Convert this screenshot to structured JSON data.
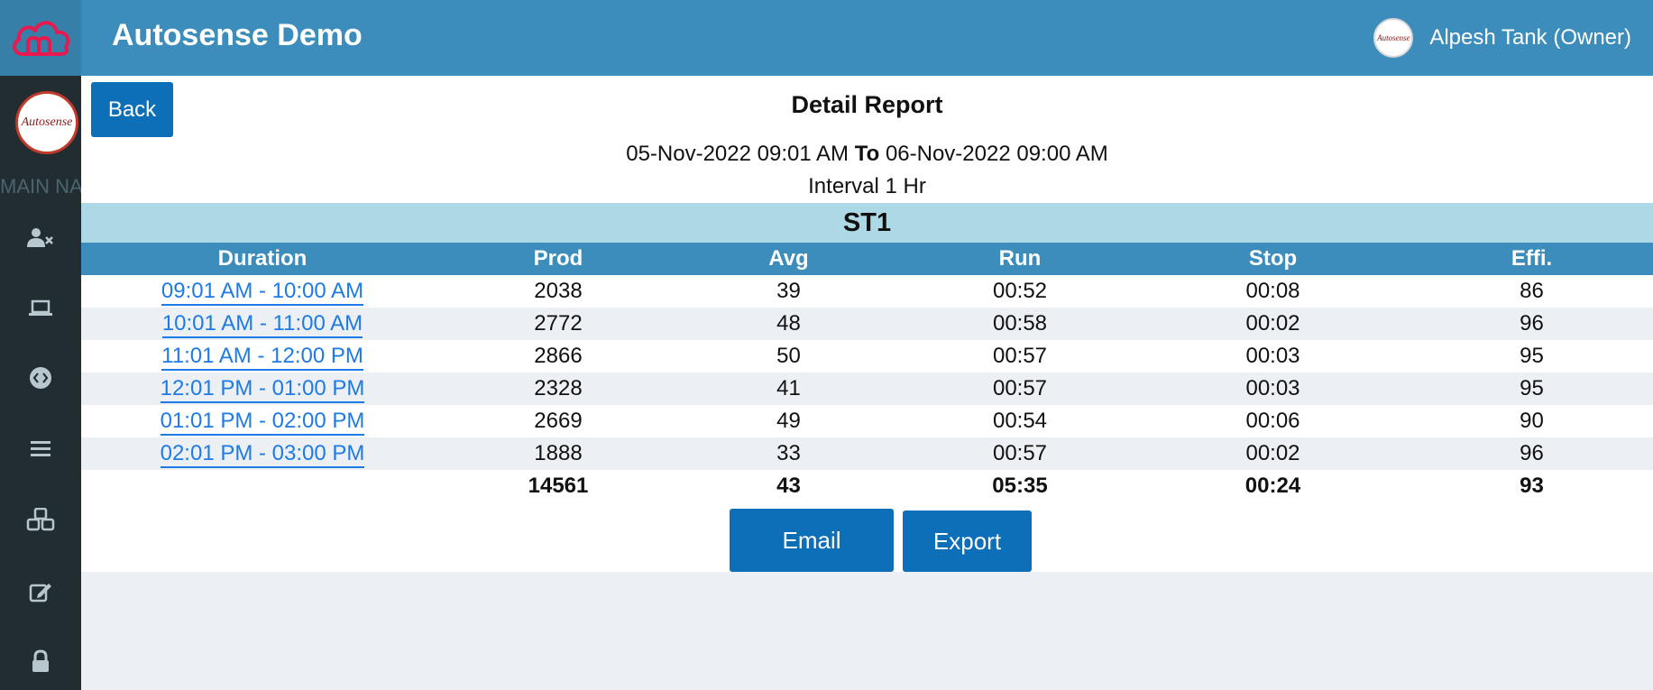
{
  "header": {
    "title": "Autosense Demo",
    "user_name": "Alpesh Tank (Owner)",
    "logo_icon": "cloud-logo-icon"
  },
  "sidebar": {
    "avatar_text": "Autosense",
    "avatar_subtext": "",
    "section_label": "MAIN NAVIGATION",
    "items": [
      {
        "icon": "user-remove-icon"
      },
      {
        "icon": "laptop-icon"
      },
      {
        "icon": "code-circle-icon"
      },
      {
        "icon": "menu-list-icon"
      },
      {
        "icon": "cubes-icon"
      },
      {
        "icon": "edit-icon"
      },
      {
        "icon": "lock-icon"
      }
    ]
  },
  "report": {
    "back_label": "Back",
    "title": "Detail Report",
    "date_from": "05-Nov-2022 09:01 AM",
    "date_to_word": "To",
    "date_to": "06-Nov-2022 09:00 AM",
    "interval": "Interval 1 Hr",
    "station": "ST1",
    "columns": [
      "Duration",
      "Prod",
      "Avg",
      "Run",
      "Stop",
      "Effi."
    ],
    "rows": [
      {
        "duration": "09:01 AM - 10:00 AM",
        "prod": "2038",
        "avg": "39",
        "run": "00:52",
        "stop": "00:08",
        "effi": "86"
      },
      {
        "duration": "10:01 AM - 11:00 AM",
        "prod": "2772",
        "avg": "48",
        "run": "00:58",
        "stop": "00:02",
        "effi": "96"
      },
      {
        "duration": "11:01 AM - 12:00 PM",
        "prod": "2866",
        "avg": "50",
        "run": "00:57",
        "stop": "00:03",
        "effi": "95"
      },
      {
        "duration": "12:01 PM - 01:00 PM",
        "prod": "2328",
        "avg": "41",
        "run": "00:57",
        "stop": "00:03",
        "effi": "95"
      },
      {
        "duration": "01:01 PM - 02:00 PM",
        "prod": "2669",
        "avg": "49",
        "run": "00:54",
        "stop": "00:06",
        "effi": "90"
      },
      {
        "duration": "02:01 PM - 03:00 PM",
        "prod": "1888",
        "avg": "33",
        "run": "00:57",
        "stop": "00:02",
        "effi": "96"
      }
    ],
    "totals": {
      "prod": "14561",
      "avg": "43",
      "run": "05:35",
      "stop": "00:24",
      "effi": "93"
    },
    "email_label": "Email",
    "export_label": "Export"
  },
  "colors": {
    "header": "#3c8dbc",
    "sidebar": "#222d32",
    "button": "#0d6fb8",
    "station_bar": "#add8e6",
    "link": "#1e7be5",
    "logo": "#e8194f"
  }
}
